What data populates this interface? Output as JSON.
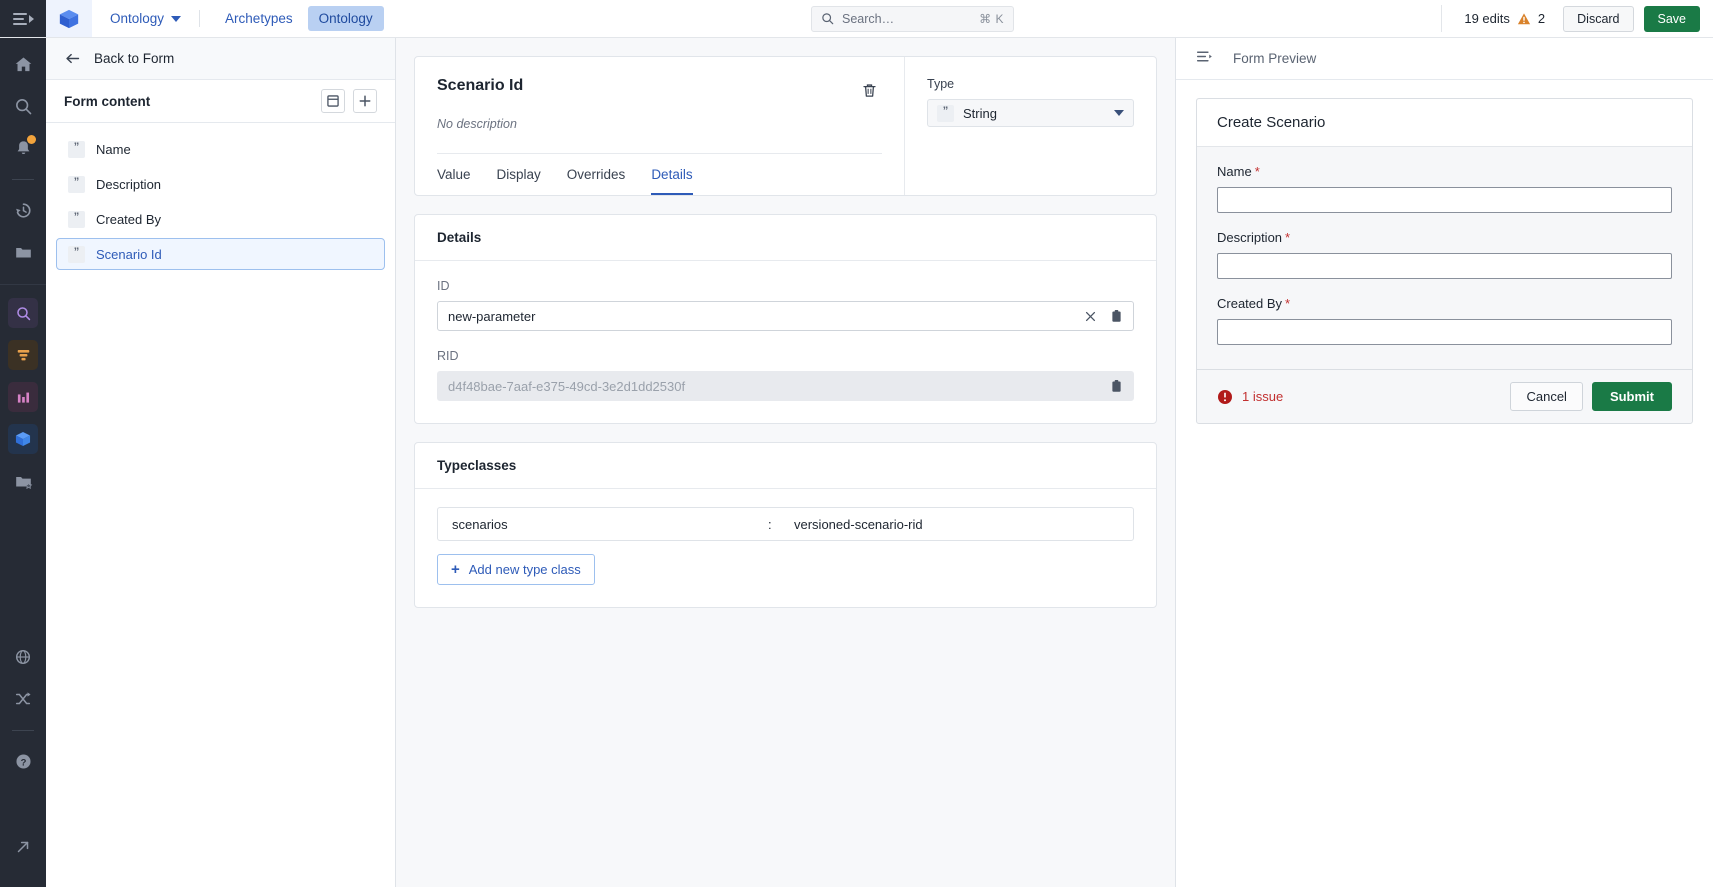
{
  "topbar": {
    "menu_icon": "hamburger-collapse-icon",
    "logo_icon": "cube-logo-icon",
    "app_name": "Ontology",
    "nav_items": [
      {
        "label": "Archetypes",
        "active": false
      },
      {
        "label": "Ontology",
        "active": true
      }
    ],
    "search": {
      "icon": "search-icon",
      "placeholder": "Search…",
      "shortcut": "⌘ K"
    },
    "edits_label": "19 edits",
    "warning_icon": "warning-triangle-icon",
    "warning_count": "2",
    "discard_label": "Discard",
    "save_label": "Save"
  },
  "rail": {
    "items": [
      {
        "name": "home-icon"
      },
      {
        "name": "search-icon"
      },
      {
        "name": "notifications-bell-icon",
        "badge": true
      },
      {
        "name": "history-clock-icon"
      },
      {
        "name": "folder-icon"
      },
      {
        "name": "magnifier-app-icon"
      },
      {
        "name": "funnel-app-icon"
      },
      {
        "name": "chart-app-icon"
      },
      {
        "name": "ontology-cube-app-icon",
        "active": true
      },
      {
        "name": "folder-star-icon"
      },
      {
        "name": "globe-icon"
      },
      {
        "name": "shuffle-icon"
      },
      {
        "name": "help-circle-icon"
      },
      {
        "name": "external-link-icon"
      }
    ]
  },
  "sidebar": {
    "back_icon": "arrow-left-icon",
    "back_label": "Back to Form",
    "section_title": "Form content",
    "layout_icon": "layout-panel-icon",
    "add_icon": "plus-icon",
    "items": [
      {
        "label": "Name",
        "icon": "string-type-icon",
        "selected": false
      },
      {
        "label": "Description",
        "icon": "string-type-icon",
        "selected": false
      },
      {
        "label": "Created By",
        "icon": "string-type-icon",
        "selected": false
      },
      {
        "label": "Scenario Id",
        "icon": "string-type-icon",
        "selected": true
      }
    ]
  },
  "editor": {
    "title": "Scenario Id",
    "description": "No description",
    "delete_icon": "trash-icon",
    "tabs": [
      {
        "label": "Value",
        "active": false
      },
      {
        "label": "Display",
        "active": false
      },
      {
        "label": "Overrides",
        "active": false
      },
      {
        "label": "Details",
        "active": true
      }
    ],
    "type_label": "Type",
    "type_value": "String",
    "type_icon": "string-type-icon",
    "details": {
      "card_title": "Details",
      "id_label": "ID",
      "id_value": "new-parameter",
      "clear_icon": "close-x-icon",
      "copy_icon": "clipboard-copy-icon",
      "rid_label": "RID",
      "rid_value": "d4f48bae-7aaf-e375-49cd-3e2d1dd2530f"
    },
    "typeclasses": {
      "card_title": "Typeclasses",
      "rows": [
        {
          "key": "scenarios",
          "separator": ":",
          "value": "versioned-scenario-rid"
        }
      ],
      "add_label": "Add new type class",
      "add_icon": "plus-icon"
    }
  },
  "preview": {
    "panel_icon": "collapse-panel-icon",
    "panel_title": "Form Preview",
    "dialog": {
      "title": "Create Scenario",
      "fields": [
        {
          "label": "Name",
          "required": "*",
          "value": ""
        },
        {
          "label": "Description",
          "required": "*",
          "value": ""
        },
        {
          "label": "Created By",
          "required": "*",
          "value": ""
        }
      ],
      "issue_icon": "error-circle-icon",
      "issue_text": "1 issue",
      "cancel_label": "Cancel",
      "submit_label": "Submit"
    }
  },
  "colors": {
    "accent_blue": "#2e5bb8",
    "save_green": "#1a7a46",
    "error_red": "#c23030",
    "warning_orange": "#d9822b",
    "rail_dark": "#262b35"
  }
}
